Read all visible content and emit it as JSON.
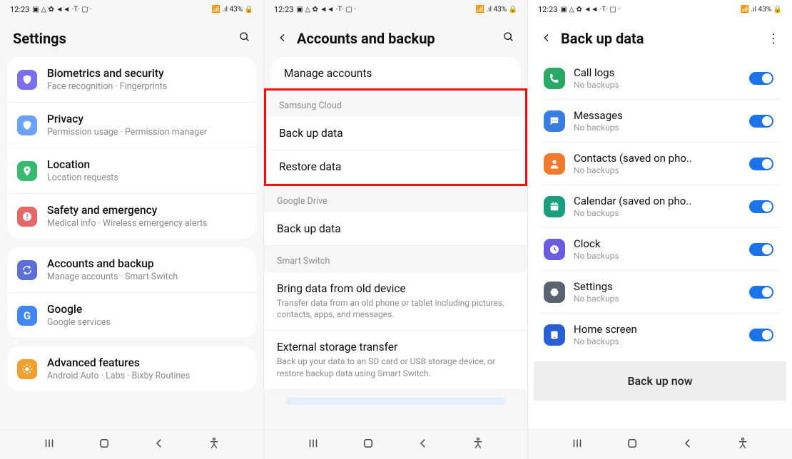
{
  "statusbar": {
    "time": "12:23",
    "indicators": "▣ △ ✿ ◄◄ ·T· ▢ ·",
    "right": "📶 .ıl 43% 🔒"
  },
  "screen1": {
    "title": "Settings",
    "items": [
      {
        "icon": "shield",
        "color": "#7b6ff0",
        "title": "Biometrics and security",
        "sub": "Face recognition  ·  Fingerprints"
      },
      {
        "icon": "shield",
        "color": "#6aa3ff",
        "title": "Privacy",
        "sub": "Permission usage  ·  Permission manager"
      },
      {
        "icon": "pin",
        "color": "#3ab971",
        "title": "Location",
        "sub": "Location requests"
      },
      {
        "icon": "alert",
        "color": "#e66868",
        "title": "Safety and emergency",
        "sub": "Medical info  ·  Wireless emergency alerts"
      },
      {
        "icon": "sync",
        "color": "#5b6fd4",
        "title": "Accounts and backup",
        "sub": "Manage accounts  ·  Smart Switch"
      },
      {
        "icon": "google",
        "color": "#4285f4",
        "title": "Google",
        "sub": "Google services"
      },
      {
        "icon": "gear-dot",
        "color": "#f0a030",
        "title": "Advanced features",
        "sub": "Android Auto  ·  Labs  ·  Bixby Routines"
      }
    ]
  },
  "screen2": {
    "title": "Accounts and backup",
    "manage": "Manage accounts",
    "sections": [
      {
        "label": "Samsung Cloud",
        "items": [
          {
            "title": "Back up data"
          },
          {
            "title": "Restore data"
          }
        ],
        "highlight": true
      },
      {
        "label": "Google Drive",
        "items": [
          {
            "title": "Back up data"
          }
        ]
      },
      {
        "label": "Smart Switch",
        "items": [
          {
            "title": "Bring data from old device",
            "desc": "Transfer data from an old phone or tablet including pictures, contacts, apps, and messages."
          },
          {
            "title": "External storage transfer",
            "desc": "Back up your data to an SD card or USB storage device, or restore backup data using Smart Switch."
          }
        ]
      }
    ]
  },
  "screen3": {
    "title": "Back up data",
    "items": [
      {
        "icon": "phone",
        "color": "#2aa866",
        "title": "Call logs",
        "sub": "No backups",
        "on": true
      },
      {
        "icon": "message",
        "color": "#3a7de0",
        "title": "Messages",
        "sub": "No backups",
        "on": true
      },
      {
        "icon": "contact",
        "color": "#f07a2e",
        "title": "Contacts (saved on pho..",
        "sub": "No backups",
        "on": true
      },
      {
        "icon": "calendar",
        "color": "#1a9e7f",
        "title": "Calendar (saved on pho..",
        "sub": "No backups",
        "on": true
      },
      {
        "icon": "clock",
        "color": "#6a5ce0",
        "title": "Clock",
        "sub": "No backups",
        "on": true
      },
      {
        "icon": "gear",
        "color": "#5a6470",
        "title": "Settings",
        "sub": "No backups",
        "on": true
      },
      {
        "icon": "home",
        "color": "#2a5ed6",
        "title": "Home screen",
        "sub": "No backups",
        "on": true
      }
    ],
    "action": "Back up now"
  },
  "nav": {
    "recents": "|||",
    "home": "◯",
    "back": "‹"
  }
}
